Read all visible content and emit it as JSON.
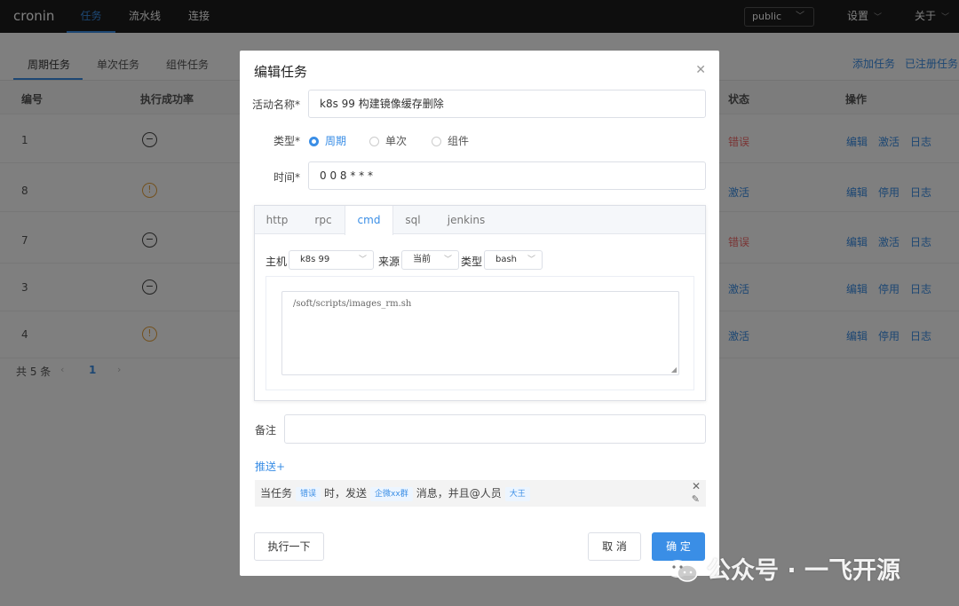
{
  "app": {
    "brand": "cronin"
  },
  "topnav": {
    "items": [
      "任务",
      "流水线",
      "连接"
    ]
  },
  "namespace": {
    "value": "public"
  },
  "topmenu": {
    "settings": "设置",
    "about": "关于"
  },
  "page_tabs": [
    "周期任务",
    "单次任务",
    "组件任务"
  ],
  "toolbar": {
    "add_task": "添加任务",
    "registered": "已注册任务"
  },
  "table": {
    "headers": {
      "id": "编号",
      "success_rate": "执行成功率",
      "status": "状态",
      "actions": "操作"
    },
    "rows": [
      {
        "id": "1",
        "state_icon": "minus-circle-icon",
        "status": "错误",
        "actions": [
          "编辑",
          "激活",
          "日志"
        ]
      },
      {
        "id": "8",
        "state_icon": "warning-circle-icon",
        "status": "激活",
        "actions": [
          "编辑",
          "停用",
          "日志"
        ]
      },
      {
        "id": "7",
        "state_icon": "minus-circle-icon",
        "status": "错误",
        "actions": [
          "编辑",
          "激活",
          "日志"
        ]
      },
      {
        "id": "3",
        "state_icon": "minus-circle-icon",
        "status": "激活",
        "actions": [
          "编辑",
          "停用",
          "日志"
        ]
      },
      {
        "id": "4",
        "state_icon": "warning-circle-icon",
        "status": "激活",
        "actions": [
          "编辑",
          "停用",
          "日志"
        ]
      }
    ],
    "total": "共 5 条",
    "page": "1"
  },
  "dialog": {
    "title": "编辑任务",
    "name_label": "活动名称*",
    "name_value": "k8s 99 构建镜像缓存删除",
    "type_label": "类型*",
    "type_options": [
      "周期",
      "单次",
      "组件"
    ],
    "type_selected": "周期",
    "time_label": "时间*",
    "time_value": "0 0 8 * * *",
    "protocol_tabs": [
      "http",
      "rpc",
      "cmd",
      "sql",
      "jenkins"
    ],
    "protocol_selected": "cmd",
    "host_label": "主机",
    "host_value": "k8s 99",
    "source_label": "来源",
    "source_value": "当前",
    "shell_label": "类型",
    "shell_value": "bash",
    "script": "/soft/scripts/images_rm.sh",
    "remark_label": "备注",
    "remark_value": "",
    "push_label": "推送+",
    "rule": {
      "prefix": "当任务",
      "status_tag": "错误",
      "mid1": "时，发送",
      "channel_tag": "企微xx群",
      "mid2": "消息，并且@人员",
      "user_tag": "大王"
    },
    "run_once": "执行一下",
    "cancel": "取 消",
    "confirm": "确 定"
  },
  "watermark": {
    "text": "公众号 · 一飞开源"
  },
  "colors": {
    "accent": "#3a8ee6",
    "error": "#f56c6c",
    "warning": "#e6a23c",
    "topbar": "#1c1c1c"
  }
}
